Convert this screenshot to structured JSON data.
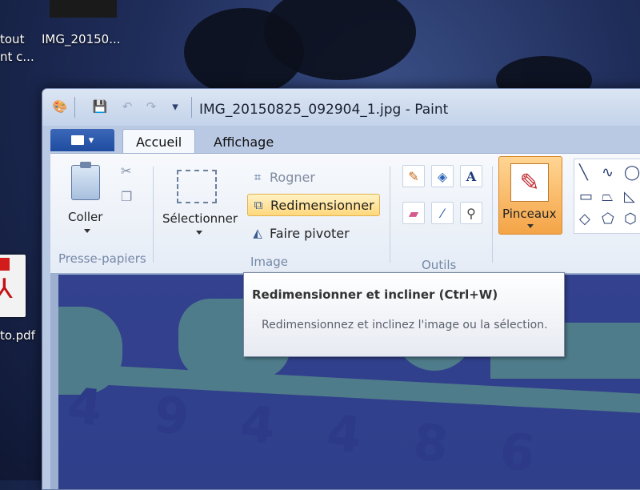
{
  "desktop": {
    "items": [
      {
        "label_line1": "tout",
        "label_line2": "nt c..."
      },
      {
        "label_line1": "IMG_20150..."
      },
      {
        "label_line1": "to.pdf"
      }
    ]
  },
  "window": {
    "title": "IMG_20150825_092904_1.jpg - Paint",
    "tabs": [
      {
        "label": "Accueil",
        "active": true
      },
      {
        "label": "Affichage",
        "active": false
      }
    ]
  },
  "ribbon": {
    "clipboard": {
      "paste_label": "Coller",
      "group_label": "Presse-papiers"
    },
    "image": {
      "select_label": "Sélectionner",
      "crop_label": "Rogner",
      "resize_label": "Redimensionner",
      "rotate_label": "Faire pivoter",
      "group_label": "Image"
    },
    "tools": {
      "group_label": "Outils",
      "text_glyph": "A"
    },
    "brushes": {
      "label": "Pinceaux"
    }
  },
  "tooltip": {
    "title": "Redimensionner et incliner (Ctrl+W)",
    "body": "Redimensionnez et inclinez l'image ou la sélection."
  },
  "canvas": {
    "digits": "4 9 4 4 8 6"
  },
  "colors": {
    "accent_hover": "#ffd87c",
    "brush_button": "#f4a447",
    "file_menu": "#1e4c9f"
  }
}
